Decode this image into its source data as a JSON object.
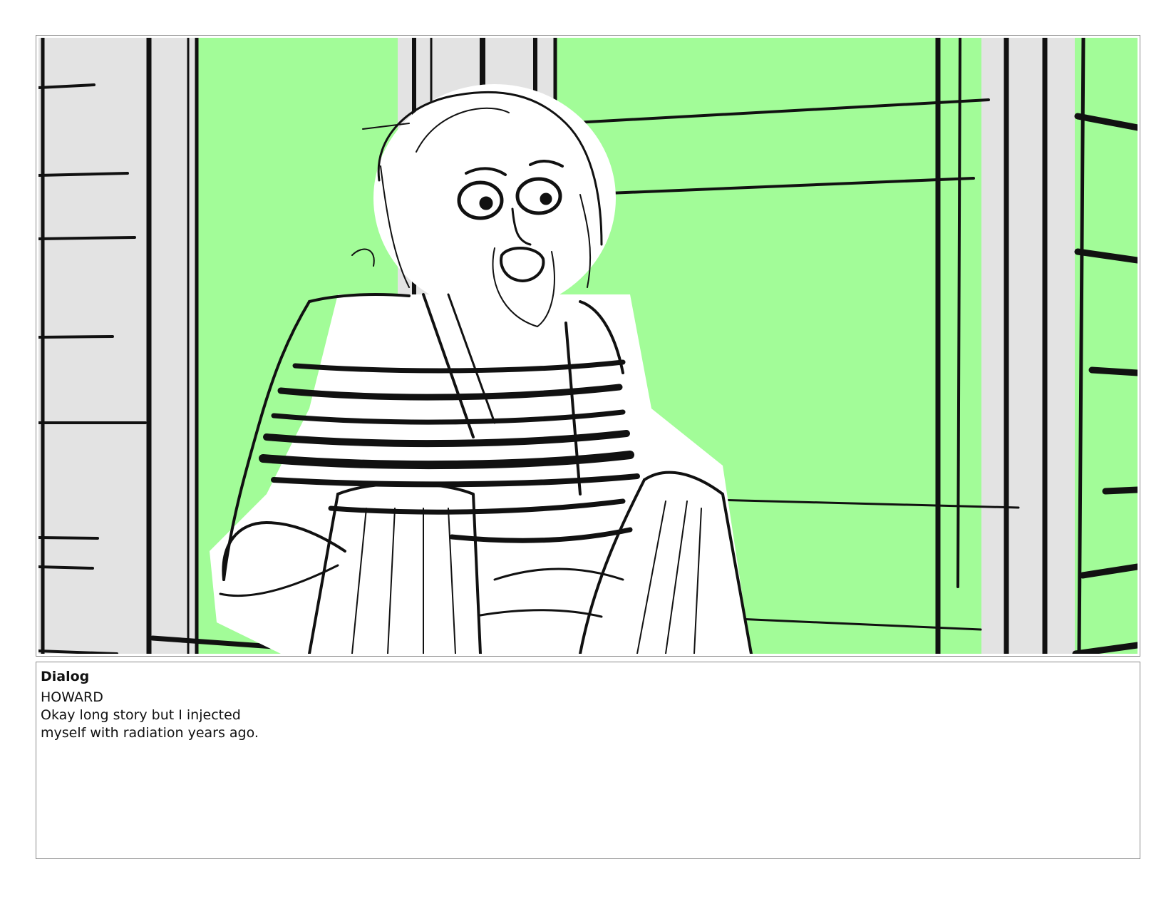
{
  "panel": {
    "image_description_icon": "storyboard-sketch",
    "colors": {
      "background_green": "#a2fc98",
      "wall_grey": "#e3e3e3",
      "ink": "#111111",
      "figure_fill": "#ffffff"
    }
  },
  "dialog": {
    "heading": "Dialog",
    "speaker": "HOWARD",
    "line1": "Okay long story but I injected",
    "line2": "myself with radiation years ago."
  }
}
